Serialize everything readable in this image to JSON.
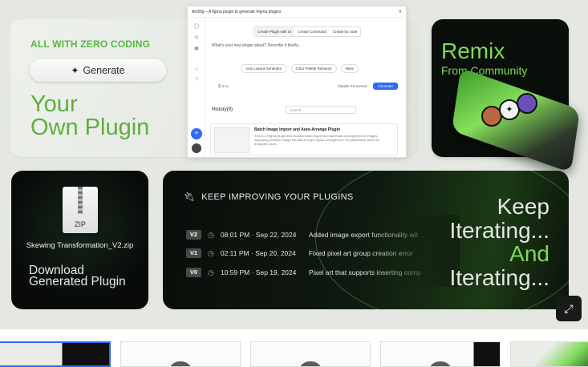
{
  "card_plugin": {
    "tagline": "ALL WITH ZERO CODING",
    "generate_label": "Generate",
    "title_line1": "Your",
    "title_line2": "Own Plugin"
  },
  "plugin_window": {
    "title": "Ant2fig – A figma plugin to generate Figma plugins",
    "tabs": [
      "Create Plugin with UI",
      "Create Command",
      "Create by code"
    ],
    "prompt_placeholder": "What's your new plugin about? Describe it briefly...",
    "chips": [
      "Auto Layout Generator",
      "Color Palette Extractor",
      "More"
    ],
    "model": "Claude 3.5 sonnet",
    "send_label": "Generate",
    "history_label": "History(9)",
    "search_placeholder": "Search",
    "item_title": "Batch Image Import and Auto-Arrange Plugin",
    "item_desc": "This is a Figma plugin that enables batch import and automatic arrangement of images, supporting multiple image formats and grid layout arrangement. It's particularly useful for designers work..."
  },
  "card_remix": {
    "title": "Remix",
    "subtitle": "From Community"
  },
  "card_zip": {
    "icon_label": "ZIP",
    "filename": "Skewing Transformation_V2.zip",
    "title_line1": "Download",
    "title_line2": "Generated Plugin"
  },
  "card_iterate": {
    "heading": "KEEP IMPROVING YOUR PLUGINS",
    "versions": [
      {
        "tag": "V2",
        "when": "08:01 PM · Sep 22, 2024",
        "note": "Added image export functionality wit"
      },
      {
        "tag": "V1",
        "when": "02:11 PM · Sep 20, 2024",
        "note": "Fixed pixel art group creation error"
      },
      {
        "tag": "V0",
        "when": "10:59 PM · Sep 19, 2024",
        "note": "Pixel art that supports inserting comp"
      }
    ],
    "keep_line1": "Keep",
    "keep_line2": "Iterating...",
    "keep_line3": "And",
    "keep_line4": "Iterating..."
  },
  "colors": {
    "accent_green": "#7ed957",
    "title_green": "#5eae3e",
    "primary_blue": "#2d6cf5"
  }
}
